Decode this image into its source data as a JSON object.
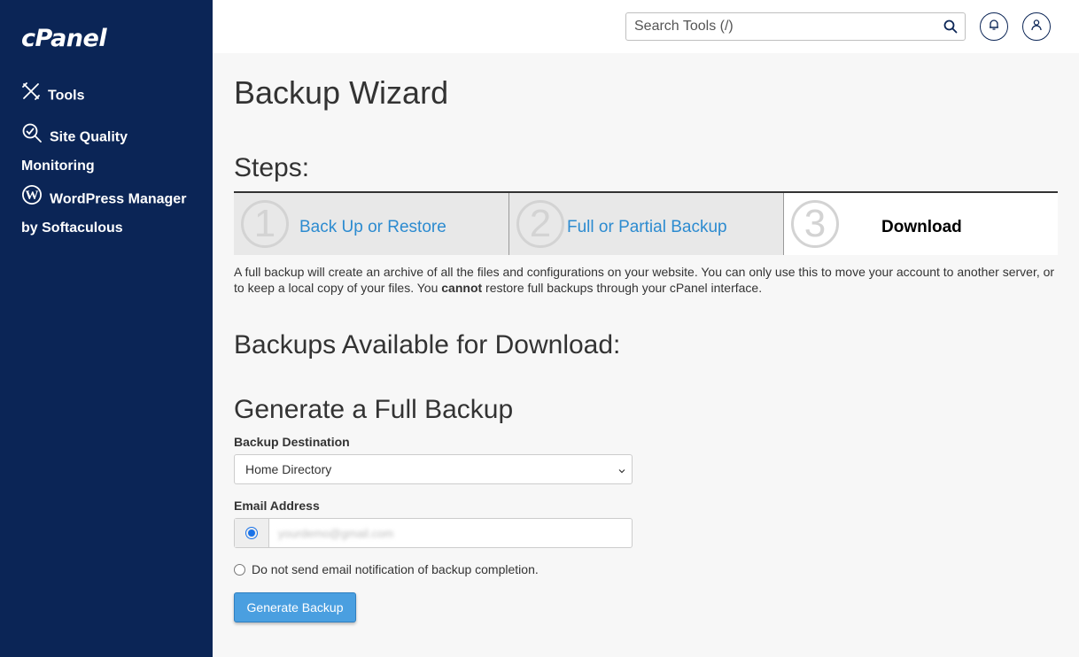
{
  "sidebar": {
    "logo": "cPanel",
    "items": [
      {
        "label": "Tools",
        "icon": "tools-icon"
      },
      {
        "label": "Site Quality",
        "label2": "Monitoring",
        "icon": "site-quality-icon"
      },
      {
        "label": "WordPress Manager",
        "label2": "by Softaculous",
        "icon": "wordpress-icon"
      }
    ]
  },
  "header": {
    "search_placeholder": "Search Tools (/)"
  },
  "main": {
    "title": "Backup Wizard",
    "steps_label": "Steps:",
    "steps": [
      {
        "number": "1",
        "label": "Back Up or Restore"
      },
      {
        "number": "2",
        "label": "Full or Partial Backup"
      },
      {
        "number": "3",
        "label": "Download"
      }
    ],
    "description_part1": "A full backup will create an archive of all the files and configurations on your website. You can only use this to move your account to another server, or to keep a local copy of your files. You ",
    "description_bold": "cannot",
    "description_part2": " restore full backups through your cPanel interface.",
    "backups_heading": "Backups Available for Download:",
    "generate_heading": "Generate a Full Backup",
    "destination_label": "Backup Destination",
    "destination_value": "Home Directory",
    "email_label": "Email Address",
    "email_value": "yourdemo@gmail.com",
    "no_email_label": "Do not send email notification of backup completion.",
    "generate_button": "Generate Backup"
  },
  "colors": {
    "sidebar_bg": "#0b2556",
    "link": "#2c8bd0",
    "button": "#4a9fe0"
  }
}
